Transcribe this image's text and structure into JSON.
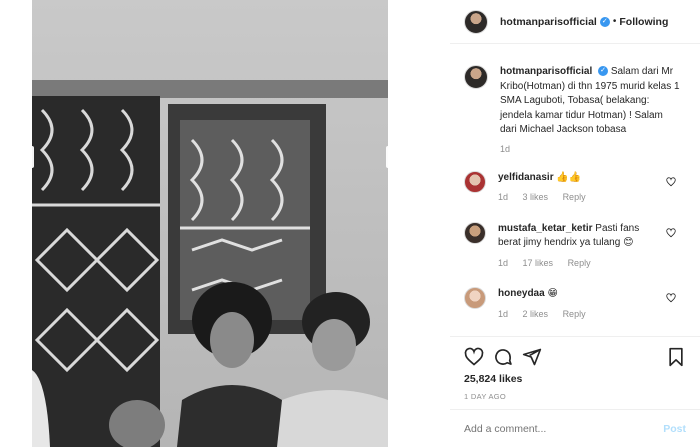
{
  "header": {
    "username": "hotmanparisofficial",
    "separator": "•",
    "follow_label": "Following"
  },
  "caption": {
    "username": "hotmanparisofficial",
    "text": "Salam dari Mr Kribo(Hotman) di thn 1975 murid kelas 1 SMA Laguboti, Tobasa( belakang: jendela kamar tidur Hotman) ! Salam dari Michael Jackson tobasa",
    "age": "1d"
  },
  "comments": [
    {
      "username": "yelfidanasir",
      "text": "👍👍",
      "age": "1d",
      "likes": "3 likes",
      "reply": "Reply"
    },
    {
      "username": "mustafa_ketar_ketir",
      "text": "Pasti fans berat jimy hendrix ya tulang 😊",
      "age": "1d",
      "likes": "17 likes",
      "reply": "Reply"
    },
    {
      "username": "honeydaa",
      "text": "😁",
      "age": "1d",
      "likes": "2 likes",
      "reply": "Reply"
    }
  ],
  "actions": {
    "likes": "25,824 likes",
    "time_ago": "1 DAY AGO"
  },
  "add_comment": {
    "placeholder": "Add a comment...",
    "post_label": "Post"
  },
  "icons": [
    "heart-icon",
    "comment-icon",
    "share-icon",
    "bookmark-icon",
    "verified-icon"
  ],
  "colors": {
    "verified": "#3897f0",
    "post_disabled": "#b2dffc",
    "muted": "#8e8e8e"
  }
}
